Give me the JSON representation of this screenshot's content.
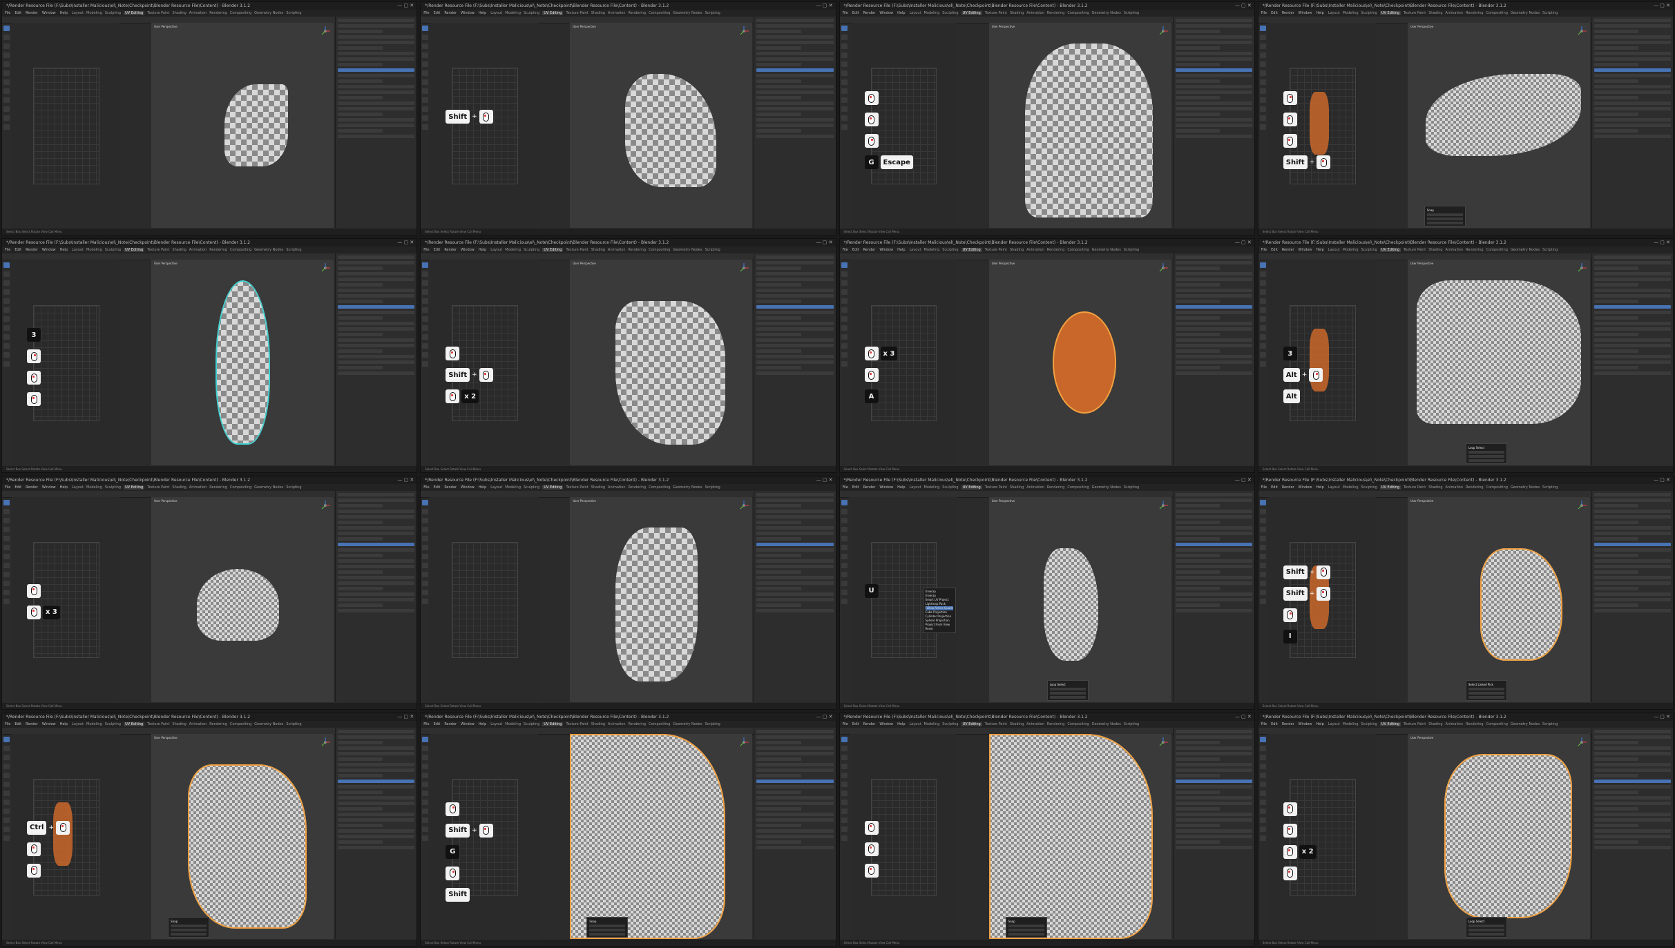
{
  "window_title": "*/Render Resource File (F:\\Subs\\Installer Malicious\\el\\_Note\\Checkpoint\\Blender Resource File\\Content) - Blender 3.1.2",
  "menus": [
    "File",
    "Edit",
    "Render",
    "Window",
    "Help"
  ],
  "workspaces": [
    "Layout",
    "Modeling",
    "Sculpting",
    "UV Editing",
    "Texture Paint",
    "Shading",
    "Animation",
    "Rendering",
    "Compositing",
    "Geometry Nodes",
    "Scripting"
  ],
  "active_workspace": "UV Editing",
  "viewport_label": "User Perspective",
  "status_text": "Select   Box Select   Rotate View   Call Menu",
  "colors": {
    "accent": "#4772b3",
    "selection": "#f0a040",
    "uv_orange": "#c9672a",
    "cyan_edge": "#40d0d0"
  },
  "panels": [
    {
      "id": "p1",
      "keys": []
    },
    {
      "id": "p2",
      "keys": [
        {
          "items": [
            "Shift",
            "+",
            "mouse-lmb"
          ]
        }
      ]
    },
    {
      "id": "p3",
      "keys": [
        {
          "items": [
            "mouse-lmb"
          ]
        },
        {
          "items": [
            "mouse-lmb"
          ]
        },
        {
          "items": [
            "mouse-rmb"
          ]
        },
        {
          "items": [
            "G",
            "Escape"
          ]
        }
      ]
    },
    {
      "id": "p4",
      "keys": [
        {
          "items": [
            "mouse-rmb"
          ]
        },
        {
          "items": [
            "mouse-lmb"
          ]
        },
        {
          "items": [
            "mouse-lmb"
          ]
        },
        {
          "items": [
            "Shift",
            "+",
            "mouse-lmb"
          ]
        }
      ]
    },
    {
      "id": "p5",
      "keys": [
        {
          "items": [
            "3"
          ]
        },
        {
          "items": [
            "mouse-rmb"
          ]
        },
        {
          "items": [
            "mouse-lmb"
          ]
        },
        {
          "items": [
            "mouse-lmb"
          ]
        }
      ]
    },
    {
      "id": "p6",
      "keys": [
        {
          "items": [
            "mouse-lmb"
          ]
        },
        {
          "items": [
            "Shift",
            "+",
            "mouse-lmb"
          ]
        },
        {
          "items": [
            "mouse-lmb",
            "x 2"
          ]
        }
      ]
    },
    {
      "id": "p7",
      "keys": [
        {
          "items": [
            "mouse-lmb",
            "x 3"
          ]
        },
        {
          "items": [
            "mouse-lmb"
          ]
        },
        {
          "items": [
            "A"
          ]
        }
      ]
    },
    {
      "id": "p8",
      "keys": [
        {
          "items": [
            "3"
          ]
        },
        {
          "items": [
            "Alt",
            "+",
            "mouse-rmb"
          ]
        },
        {
          "items": [
            "Alt"
          ]
        }
      ]
    },
    {
      "id": "p9",
      "keys": [
        {
          "items": [
            "mouse-lmb"
          ]
        },
        {
          "items": [
            "mouse-lmb",
            "x 3"
          ]
        }
      ]
    },
    {
      "id": "p10",
      "keys": []
    },
    {
      "id": "p11",
      "keys": [
        {
          "items": [
            "U"
          ]
        }
      ]
    },
    {
      "id": "p12",
      "keys": [
        {
          "items": [
            "Shift",
            "+",
            "mouse-lmb"
          ]
        },
        {
          "items": [
            "Shift",
            "+",
            "mouse-lmb"
          ]
        },
        {
          "items": [
            "mouse-rmb"
          ]
        },
        {
          "items": [
            "I"
          ]
        }
      ]
    },
    {
      "id": "p13",
      "keys": [
        {
          "items": [
            "Ctrl",
            "+",
            "mouse-lmb"
          ]
        },
        {
          "items": [
            "mouse-lmb"
          ]
        },
        {
          "items": [
            "mouse-lmb"
          ]
        }
      ]
    },
    {
      "id": "p14",
      "keys": [
        {
          "items": [
            "mouse-rmb"
          ]
        },
        {
          "items": [
            "Shift",
            "+",
            "mouse-lmb"
          ]
        },
        {
          "items": [
            "G"
          ]
        },
        {
          "items": [
            "mouse-rmb"
          ]
        },
        {
          "items": [
            "Shift"
          ]
        }
      ]
    },
    {
      "id": "p15",
      "keys": [
        {
          "items": [
            "mouse-lmb"
          ]
        },
        {
          "items": [
            "mouse-lmb"
          ]
        },
        {
          "items": [
            "mouse-lmb"
          ]
        }
      ]
    },
    {
      "id": "p16",
      "keys": [
        {
          "items": [
            "mouse-lmb"
          ]
        },
        {
          "items": [
            "mouse-lmb"
          ]
        },
        {
          "items": [
            "mouse-lmb",
            "x 2"
          ]
        },
        {
          "items": [
            "mouse-lmb"
          ]
        }
      ]
    }
  ],
  "unwrap_menu": {
    "title": "Unwrap",
    "items": [
      "Unwrap",
      "Smart UV Project",
      "Lightmap Pack",
      "Follow Active Quads",
      "Cube Projection",
      "Cylinder Projection",
      "Sphere Projection",
      "Project From View",
      "Reset"
    ]
  },
  "dialogs": {
    "loop_select": "Loop Select",
    "snap": "Snap",
    "select_linked": "Select Linked Pick"
  }
}
